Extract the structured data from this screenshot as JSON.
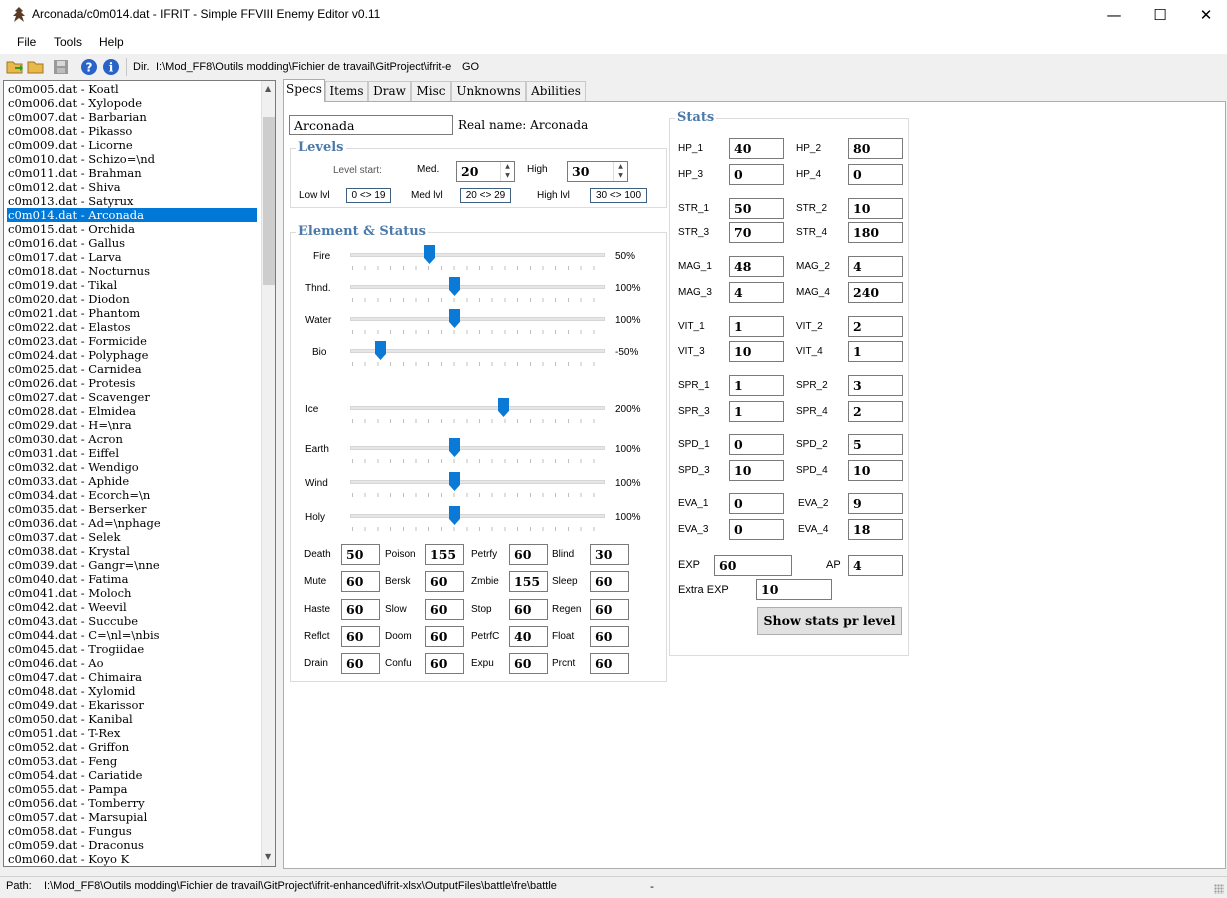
{
  "window": {
    "title": "Arconada/c0m014.dat  -  IFRIT  -  Simple FFVIII Enemy Editor v0.11",
    "min": "—",
    "max": "☐",
    "close": "✕"
  },
  "menu": [
    "File",
    "Tools",
    "Help"
  ],
  "toolbar": {
    "dir_label": "Dir.",
    "dir_value": "I:\\Mod_FF8\\Outils modding\\Fichier de travail\\GitProject\\ifrit-e",
    "go_label": "GO"
  },
  "files": [
    "c0m005.dat - Koatl",
    "c0m006.dat - Xylopode",
    "c0m007.dat - Barbarian",
    "c0m008.dat - Pikasso",
    "c0m009.dat - Licorne",
    "c0m010.dat - Schizo=\\nd",
    "c0m011.dat - Brahman",
    "c0m012.dat - Shiva",
    "c0m013.dat - Satyrux",
    "c0m014.dat - Arconada",
    "c0m015.dat - Orchida",
    "c0m016.dat - Gallus",
    "c0m017.dat - Larva",
    "c0m018.dat - Nocturnus",
    "c0m019.dat - Tikal",
    "c0m020.dat - Diodon",
    "c0m021.dat - Phantom",
    "c0m022.dat - Elastos",
    "c0m023.dat - Formicide",
    "c0m024.dat - Polyphage",
    "c0m025.dat - Carnidea",
    "c0m026.dat - Protesis",
    "c0m027.dat - Scavenger",
    "c0m028.dat - Elmidea",
    "c0m029.dat - H=\\nra",
    "c0m030.dat - Acron",
    "c0m031.dat - Eiffel",
    "c0m032.dat - Wendigo",
    "c0m033.dat - Aphide",
    "c0m034.dat - Ecorch=\\n",
    "c0m035.dat - Berserker",
    "c0m036.dat - Ad=\\nphage",
    "c0m037.dat - Selek",
    "c0m038.dat - Krystal",
    "c0m039.dat - Gangr=\\nne",
    "c0m040.dat - Fatima",
    "c0m041.dat - Moloch",
    "c0m042.dat - Weevil",
    "c0m043.dat - Succube",
    "c0m044.dat - C=\\nl=\\nbis",
    "c0m045.dat - Trogiidae",
    "c0m046.dat - Ao",
    "c0m047.dat - Chimaira",
    "c0m048.dat - Xylomid",
    "c0m049.dat - Ekarissor",
    "c0m050.dat - Kanibal",
    "c0m051.dat - T-Rex",
    "c0m052.dat - Griffon",
    "c0m053.dat - Feng",
    "c0m054.dat - Cariatide",
    "c0m055.dat - Pampa",
    "c0m056.dat - Tomberry",
    "c0m057.dat - Marsupial",
    "c0m058.dat - Fungus",
    "c0m059.dat - Draconus",
    "c0m060.dat - Koyo K"
  ],
  "tabs": [
    "Specs",
    "Items",
    "Draw",
    "Misc",
    "Unknowns",
    "Abilities"
  ],
  "specs": {
    "name_value": "Arconada",
    "real_name": "Real name: Arconada",
    "levels": {
      "title": "Levels",
      "level_start": "Level start:",
      "med_label": "Med.",
      "med_value": "20",
      "high_label": "High",
      "high_value": "30",
      "low_lvl_label": "Low lvl",
      "low_lvl_range": "0 <> 19",
      "med_lvl_label": "Med lvl",
      "med_lvl_range": "20 <> 29",
      "high_lvl_label": "High lvl",
      "high_lvl_range": "30 <> 100"
    },
    "element_status": {
      "title": "Element & Status",
      "elements": [
        {
          "name": "Fire",
          "value": "50%",
          "level": 50
        },
        {
          "name": "Thnd.",
          "value": "100%",
          "level": 100
        },
        {
          "name": "Water",
          "value": "100%",
          "level": 100
        },
        {
          "name": "Bio",
          "value": "-50%",
          "level": -50
        },
        {
          "name": "Ice",
          "value": "200%",
          "level": 200
        },
        {
          "name": "Earth",
          "value": "100%",
          "level": 100
        },
        {
          "name": "Wind",
          "value": "100%",
          "level": 100
        },
        {
          "name": "Holy",
          "value": "100%",
          "level": 100
        }
      ],
      "statuses": [
        [
          {
            "name": "Death",
            "value": "50"
          },
          {
            "name": "Poison",
            "value": "155"
          },
          {
            "name": "Petrfy",
            "value": "60"
          },
          {
            "name": "Blind",
            "value": "30"
          }
        ],
        [
          {
            "name": "Mute",
            "value": "60"
          },
          {
            "name": "Bersk",
            "value": "60"
          },
          {
            "name": "Zmbie",
            "value": "155"
          },
          {
            "name": "Sleep",
            "value": "60"
          }
        ],
        [
          {
            "name": "Haste",
            "value": "60"
          },
          {
            "name": "Slow",
            "value": "60"
          },
          {
            "name": "Stop",
            "value": "60"
          },
          {
            "name": "Regen",
            "value": "60"
          }
        ],
        [
          {
            "name": "Reflct",
            "value": "60"
          },
          {
            "name": "Doom",
            "value": "60"
          },
          {
            "name": "PetrfC",
            "value": "40"
          },
          {
            "name": "Float",
            "value": "60"
          }
        ],
        [
          {
            "name": "Drain",
            "value": "60"
          },
          {
            "name": "Confu",
            "value": "60"
          },
          {
            "name": "Expu",
            "value": "60"
          },
          {
            "name": "Prcnt",
            "value": "60"
          }
        ]
      ]
    },
    "stats": {
      "title": "Stats",
      "rows": [
        [
          {
            "name": "HP_1",
            "value": "40"
          },
          {
            "name": "HP_2",
            "value": "80"
          }
        ],
        [
          {
            "name": "HP_3",
            "value": "0"
          },
          {
            "name": "HP_4",
            "value": "0"
          }
        ],
        [
          {
            "name": "STR_1",
            "value": "50"
          },
          {
            "name": "STR_2",
            "value": "10"
          }
        ],
        [
          {
            "name": "STR_3",
            "value": "70"
          },
          {
            "name": "STR_4",
            "value": "180"
          }
        ],
        [
          {
            "name": "MAG_1",
            "value": "48"
          },
          {
            "name": "MAG_2",
            "value": "4"
          }
        ],
        [
          {
            "name": "MAG_3",
            "value": "4"
          },
          {
            "name": "MAG_4",
            "value": "240"
          }
        ],
        [
          {
            "name": "VIT_1",
            "value": "1"
          },
          {
            "name": "VIT_2",
            "value": "2"
          }
        ],
        [
          {
            "name": "VIT_3",
            "value": "10"
          },
          {
            "name": "VIT_4",
            "value": "1"
          }
        ],
        [
          {
            "name": "SPR_1",
            "value": "1"
          },
          {
            "name": "SPR_2",
            "value": "3"
          }
        ],
        [
          {
            "name": "SPR_3",
            "value": "1"
          },
          {
            "name": "SPR_4",
            "value": "2"
          }
        ],
        [
          {
            "name": "SPD_1",
            "value": "0"
          },
          {
            "name": "SPD_2",
            "value": "5"
          }
        ],
        [
          {
            "name": "SPD_3",
            "value": "10"
          },
          {
            "name": "SPD_4",
            "value": "10"
          }
        ],
        [
          {
            "name": "EVA_1",
            "value": "0"
          },
          {
            "name": "EVA_2",
            "value": "9"
          }
        ],
        [
          {
            "name": "EVA_3",
            "value": "0"
          },
          {
            "name": "EVA_4",
            "value": "18"
          }
        ]
      ],
      "exp_label": "EXP",
      "exp_value": "60",
      "ap_label": "AP",
      "ap_value": "4",
      "extra_exp_label": "Extra EXP",
      "extra_exp_value": "10",
      "show_button": "Show stats pr level"
    }
  },
  "statusbar": {
    "path_label": "Path:",
    "path_value": "I:\\Mod_FF8\\Outils modding\\Fichier de travail\\GitProject\\ifrit-enhanced\\ifrit-xlsx\\OutputFiles\\battle\\fre\\battle",
    "dash": "-"
  },
  "colors": {
    "selection": "#0078d7",
    "group_title": "#4b7aaa",
    "slider": "#0a7ad6"
  }
}
